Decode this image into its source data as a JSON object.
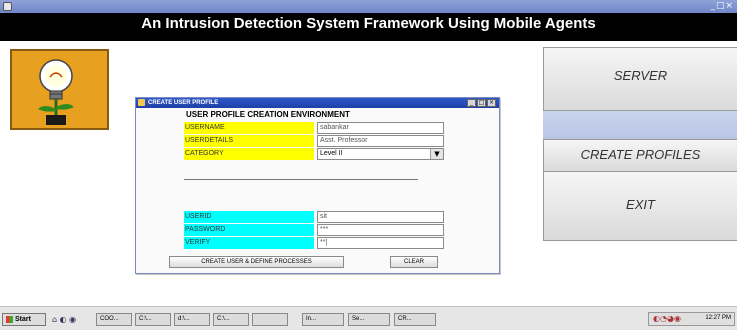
{
  "window": {
    "header_title": "An Intrusion Detection System Framework Using Mobile Agents",
    "controls": "_□×"
  },
  "side_buttons": {
    "server": "SERVER",
    "create_profiles": "CREATE PROFILES",
    "exit": "EXIT"
  },
  "dialog": {
    "title": "CREATE USER PROFILE",
    "controls": [
      "_",
      "□",
      "×"
    ],
    "heading": "USER PROFILE CREATION ENVIRONMENT",
    "fields": {
      "username": {
        "label": "USERNAME",
        "value": "sabankar"
      },
      "userdetails": {
        "label": "USERDETAILS",
        "value": "Asst. Professor"
      },
      "category": {
        "label": "CATEGORY",
        "value": "Level II"
      },
      "userid": {
        "label": "USERID",
        "value": "sit"
      },
      "password": {
        "label": "PASSWORD",
        "value": "***"
      },
      "verify": {
        "label": "VERIFY",
        "value": "**|"
      }
    },
    "buttons": {
      "create_user": "CREATE USER & DEFINE PROCESSES",
      "clear": "CLEAR"
    }
  },
  "taskbar": {
    "start": "Start",
    "quick_launch": "⌂ ◐ ◉",
    "tasks": [
      "COO...",
      "C:\\...",
      "d:\\...",
      "C:\\...",
      "",
      "In...",
      "Se...",
      "CR..."
    ],
    "tray_icons": "◐◔◕◉",
    "clock": "12:27 PM"
  },
  "colors": {
    "label_yellow": "#ffff00",
    "label_cyan": "#00ffff",
    "header_black": "#000000",
    "logo_orange": "#e8a020"
  }
}
